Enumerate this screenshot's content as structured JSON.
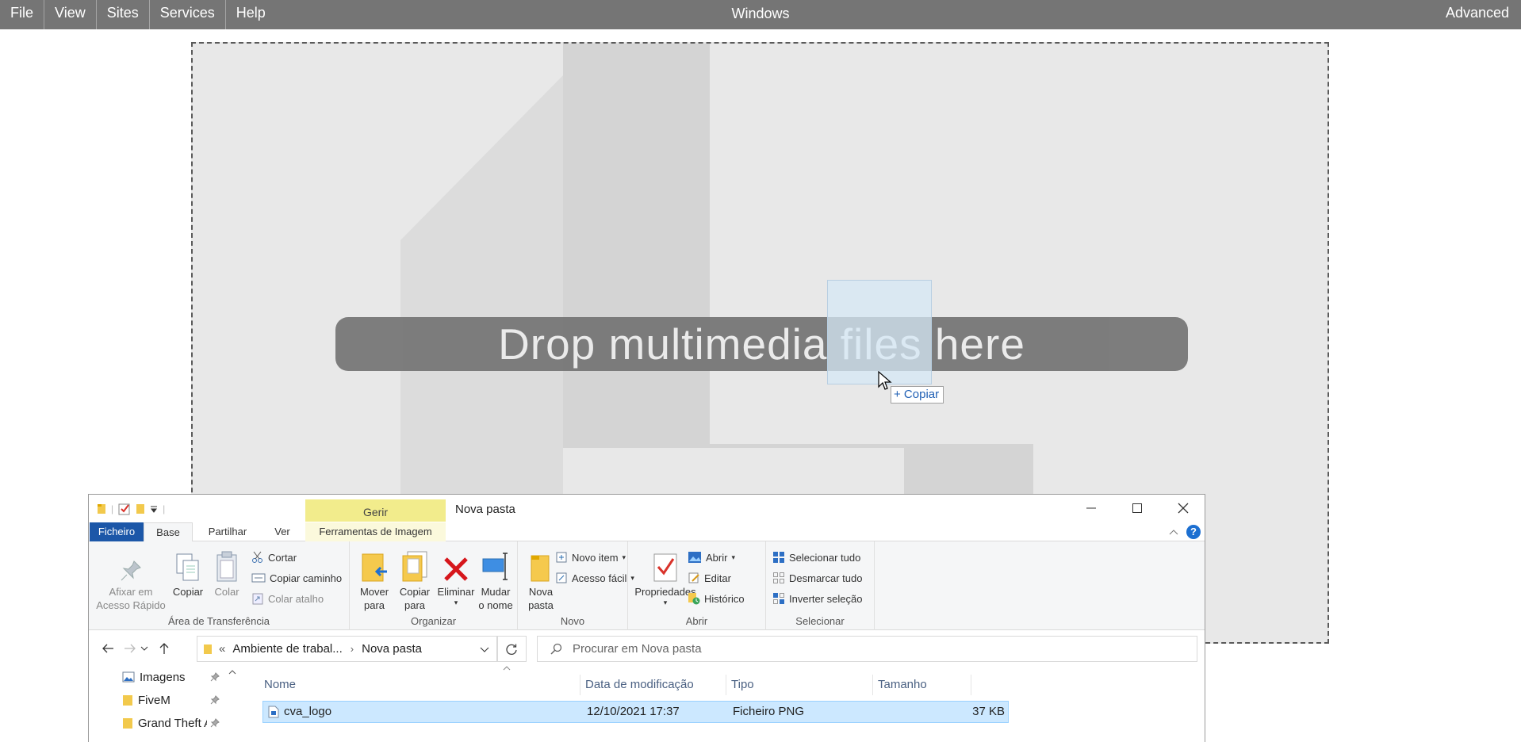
{
  "topbar": {
    "menu": [
      "File",
      "View",
      "Sites",
      "Services",
      "Help"
    ],
    "title": "Windows",
    "advanced": "Advanced"
  },
  "dropzone": {
    "label": "Drop multimedia files here",
    "drag_tooltip": "+ Copiar"
  },
  "explorer": {
    "contextual_tab_group": "Gerir",
    "window_title": "Nova pasta",
    "tabs": [
      "Ficheiro",
      "Base",
      "Partilhar",
      "Ver",
      "Ferramentas de Imagem"
    ],
    "help": "?",
    "ribbon": {
      "clipboard": {
        "label": "Área de Transferência",
        "pin": "Afixar em Acesso Rápido",
        "copy": "Copiar",
        "paste": "Colar",
        "cut": "Cortar",
        "copy_path": "Copiar caminho",
        "paste_shortcut": "Colar atalho"
      },
      "organize": {
        "label": "Organizar",
        "move_to": "Mover para",
        "copy_to": "Copiar para",
        "delete": "Eliminar",
        "rename": "Mudar o nome"
      },
      "new": {
        "label": "Novo",
        "new_folder": "Nova pasta",
        "new_item": "Novo item",
        "easy_access": "Acesso fácil"
      },
      "open": {
        "label": "Abrir",
        "properties": "Propriedades",
        "open": "Abrir",
        "edit": "Editar",
        "history": "Histórico"
      },
      "select": {
        "label": "Selecionar",
        "select_all": "Selecionar tudo",
        "select_none": "Desmarcar tudo",
        "invert": "Inverter seleção"
      }
    },
    "address": {
      "prefix": "«",
      "path": [
        "Ambiente de trabal...",
        "Nova pasta"
      ]
    },
    "search_placeholder": "Procurar em Nova pasta",
    "nav_items": [
      {
        "label": "Imagens"
      },
      {
        "label": "FiveM"
      },
      {
        "label": "Grand Theft Auto V"
      }
    ],
    "columns": [
      "Nome",
      "Data de modificação",
      "Tipo",
      "Tamanho"
    ],
    "files": [
      {
        "name": "cva_logo",
        "modified": "12/10/2021 17:37",
        "type": "Ficheiro PNG",
        "size": "37 KB"
      }
    ],
    "colors": {
      "file_tab": "#1c57a8",
      "selection": "#cce8ff",
      "gerir": "#f2ec8c"
    }
  }
}
